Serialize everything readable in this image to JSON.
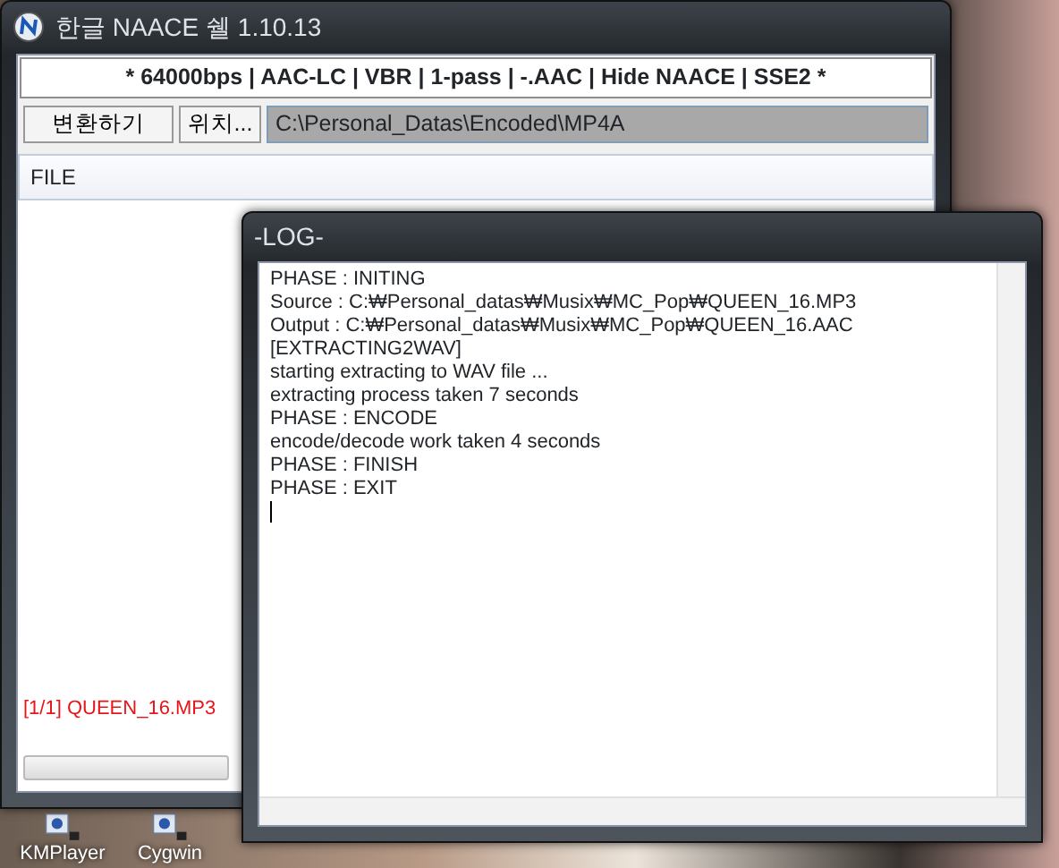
{
  "main_window": {
    "title": "한글 NAACE 쉘 1.10.13",
    "options_bar": "* 64000bps | AAC-LC | VBR | 1-pass | -.AAC | Hide NAACE | SSE2 *",
    "buttons": [
      "변환하기",
      "위치..."
    ],
    "output_path": "C:\\Personal_Datas\\Encoded\\MP4A",
    "file_list": {
      "columns": [
        "FILE"
      ]
    },
    "status": "[1/1] QUEEN_16.MP3"
  },
  "log_window": {
    "title": "-LOG-",
    "lines": [
      "PHASE : INITING",
      "Source : C:₩Personal_datas₩Musix₩MC_Pop₩QUEEN_16.MP3",
      "Output : C:₩Personal_datas₩Musix₩MC_Pop₩QUEEN_16.AAC",
      "[EXTRACTING2WAV]",
      "starting extracting to WAV file ...",
      "extracting process taken 7 seconds",
      "PHASE : ENCODE",
      "encode/decode work taken 4 seconds",
      "PHASE : FINISH",
      "PHASE : EXIT"
    ]
  },
  "desktop_icons": [
    {
      "label": "KMPlayer"
    },
    {
      "label": "Cygwin"
    }
  ]
}
